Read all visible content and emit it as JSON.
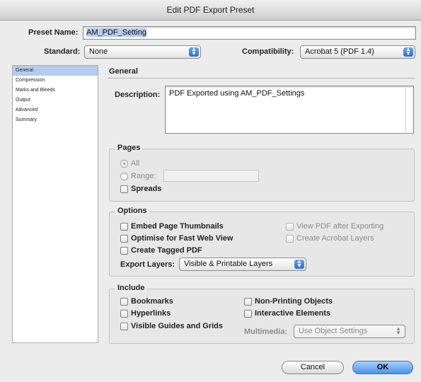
{
  "window": {
    "title": "Edit PDF Export Preset"
  },
  "preset": {
    "label": "Preset Name:",
    "value": "AM_PDF_Setting"
  },
  "standard": {
    "label": "Standard:",
    "value": "None"
  },
  "compatibility": {
    "label": "Compatibility:",
    "value": "Acrobat 5 (PDF 1.4)"
  },
  "sidebar": {
    "items": [
      "General",
      "Compression",
      "Marks and Bleeds",
      "Output",
      "Advanced",
      "Summary"
    ],
    "selected": "General"
  },
  "general": {
    "title": "General",
    "description_label": "Description:",
    "description_value": "PDF Exported using AM_PDF_Settings"
  },
  "pages": {
    "title": "Pages",
    "all_label": "All",
    "range_label": "Range:",
    "spreads_label": "Spreads"
  },
  "options": {
    "title": "Options",
    "embed_thumbnails": "Embed Page Thumbnails",
    "optimise_web": "Optimise for Fast Web View",
    "create_tagged": "Create Tagged PDF",
    "view_after": "View PDF after Exporting",
    "create_layers": "Create Acrobat Layers",
    "export_layers_label": "Export Layers:",
    "export_layers_value": "Visible & Printable Layers"
  },
  "include": {
    "title": "Include",
    "bookmarks": "Bookmarks",
    "hyperlinks": "Hyperlinks",
    "visible_guides": "Visible Guides and Grids",
    "non_printing": "Non-Printing Objects",
    "interactive": "Interactive Elements",
    "multimedia_label": "Multimedia:",
    "multimedia_value": "Use Object Settings"
  },
  "footer": {
    "cancel": "Cancel",
    "ok": "OK"
  },
  "colors": {
    "accent": "#4f93e3",
    "selection": "#b5ccec"
  }
}
